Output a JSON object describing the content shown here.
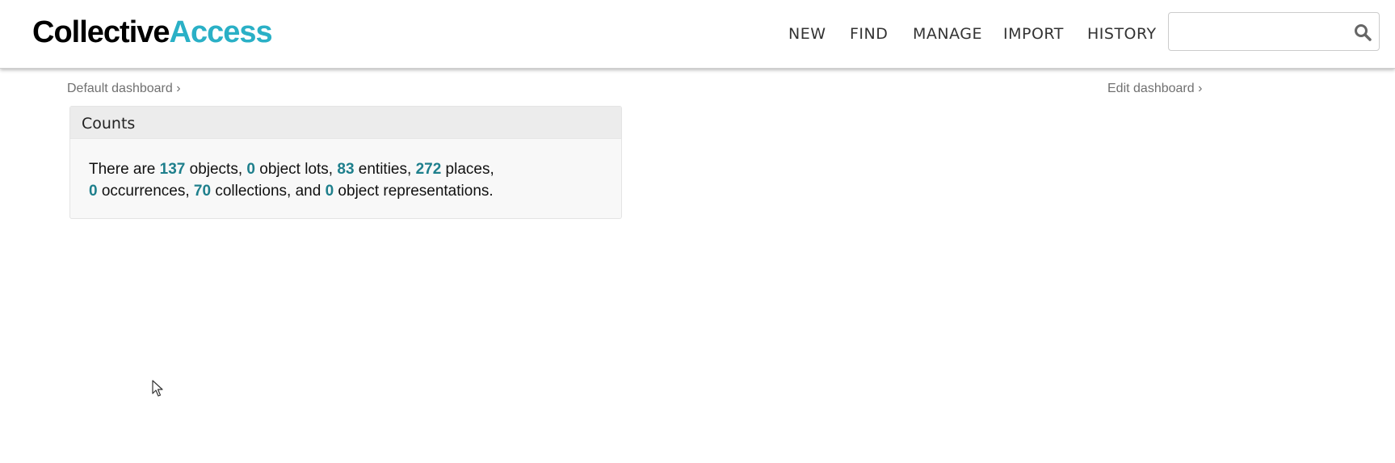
{
  "header": {
    "logo_part1": "Collective",
    "logo_part2": "Access",
    "nav": {
      "new": "NEW",
      "find": "FIND",
      "manage": "MANAGE",
      "import": "IMPORT",
      "history": "HISTORY"
    },
    "search": {
      "value": "",
      "placeholder": ""
    }
  },
  "breadcrumbs": {
    "left": "Default dashboard ›",
    "right": "Edit dashboard ›"
  },
  "widget": {
    "title": "Counts",
    "text": {
      "t1": "There are ",
      "objects": "137",
      "t2": " objects, ",
      "object_lots": "0",
      "t3": " object lots, ",
      "entities": "83",
      "t4": " entities, ",
      "places": "272",
      "t5": " places,",
      "occurrences": "0",
      "t6": " occurrences, ",
      "collections": "70",
      "t7": " collections, and ",
      "representations": "0",
      "t8": " object representations."
    }
  },
  "colors": {
    "logo_accent": "#2ab0c6",
    "count_highlight": "#1e7f8c",
    "icons": [
      "search-icon",
      "mouse-cursor-icon"
    ]
  }
}
